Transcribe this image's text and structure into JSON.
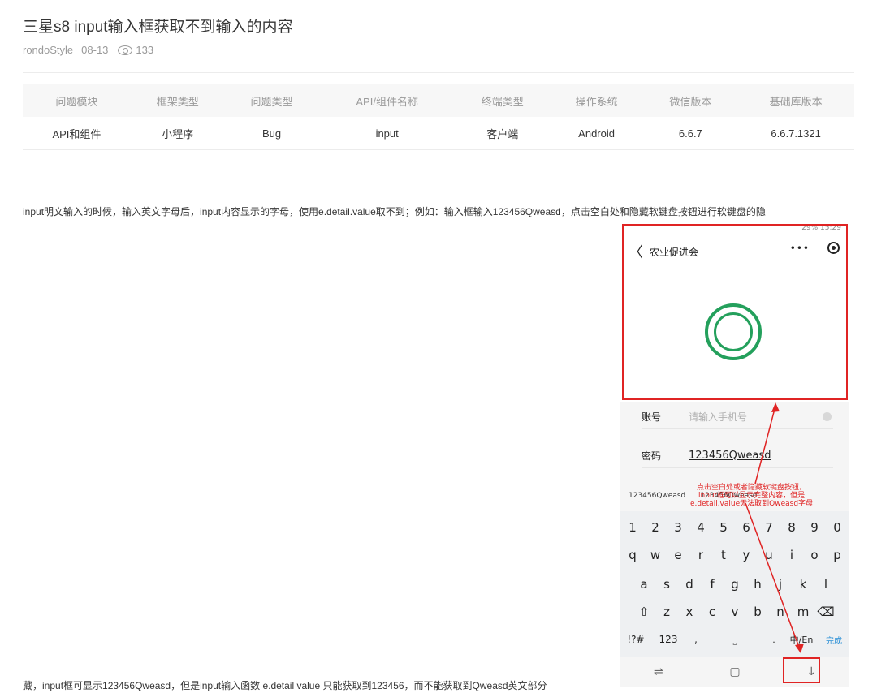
{
  "post": {
    "title": "三星s8 input输入框获取不到输入的内容",
    "author": "rondoStyle",
    "date": "08-13",
    "views": "133"
  },
  "table": {
    "headers": [
      "问题模块",
      "框架类型",
      "问题类型",
      "API/组件名称",
      "终端类型",
      "操作系统",
      "微信版本",
      "基础库版本"
    ],
    "row": [
      "API和组件",
      "小程序",
      "Bug",
      "input",
      "客户端",
      "Android",
      "6.6.7",
      "6.6.7.1321"
    ]
  },
  "body": {
    "para1": "input明文输入的时候，输入英文字母后，input内容显示的字母，使用e.detail.value取不到；例如：输入框输入123456Qweasd，点击空白处和隐藏软键盘按钮进行软键盘的隐",
    "para2": "藏，input框可显示123456Qweasd，但是input输入函数 e.detail value 只能获取到123456，而不能获取到Qweasd英文部分"
  },
  "phone": {
    "status": "29% 15:29",
    "nav_title": "农业促进会",
    "nav_back": "〈",
    "nav_dots": "•••",
    "account_label": "账号",
    "account_placeholder": "请输入手机号",
    "password_label": "密码",
    "password_value": "123456Qweasd",
    "annotation_line1": "点击空白处或者隐藏软键盘按钮，",
    "annotation_line2": "input框可以显示完整内容，但是",
    "annotation_line3": "e.detail.value无法取到Qweasd字母",
    "suggestion1": "123456Qweasd",
    "suggestion2": "123456Qweasd",
    "keys_row1": [
      "1",
      "2",
      "3",
      "4",
      "5",
      "6",
      "7",
      "8",
      "9",
      "0"
    ],
    "keys_row2": [
      "q",
      "w",
      "e",
      "r",
      "t",
      "y",
      "u",
      "i",
      "o",
      "p"
    ],
    "keys_row3": [
      "a",
      "s",
      "d",
      "f",
      "g",
      "h",
      "j",
      "k",
      "l"
    ],
    "keys_row4": [
      "⇧",
      "z",
      "x",
      "c",
      "v",
      "b",
      "n",
      "m",
      "⌫"
    ],
    "key_sym": "!?#",
    "key_num": "123",
    "key_comma": ",",
    "key_space": "⎵",
    "key_dot": ".",
    "key_lang": "中/En",
    "key_done": "完成",
    "nav_recent": "⇌",
    "nav_home": "▢",
    "nav_hide": "↓"
  },
  "colors": {
    "accent_red": "#e02424",
    "logo_green": "#24a05c"
  }
}
